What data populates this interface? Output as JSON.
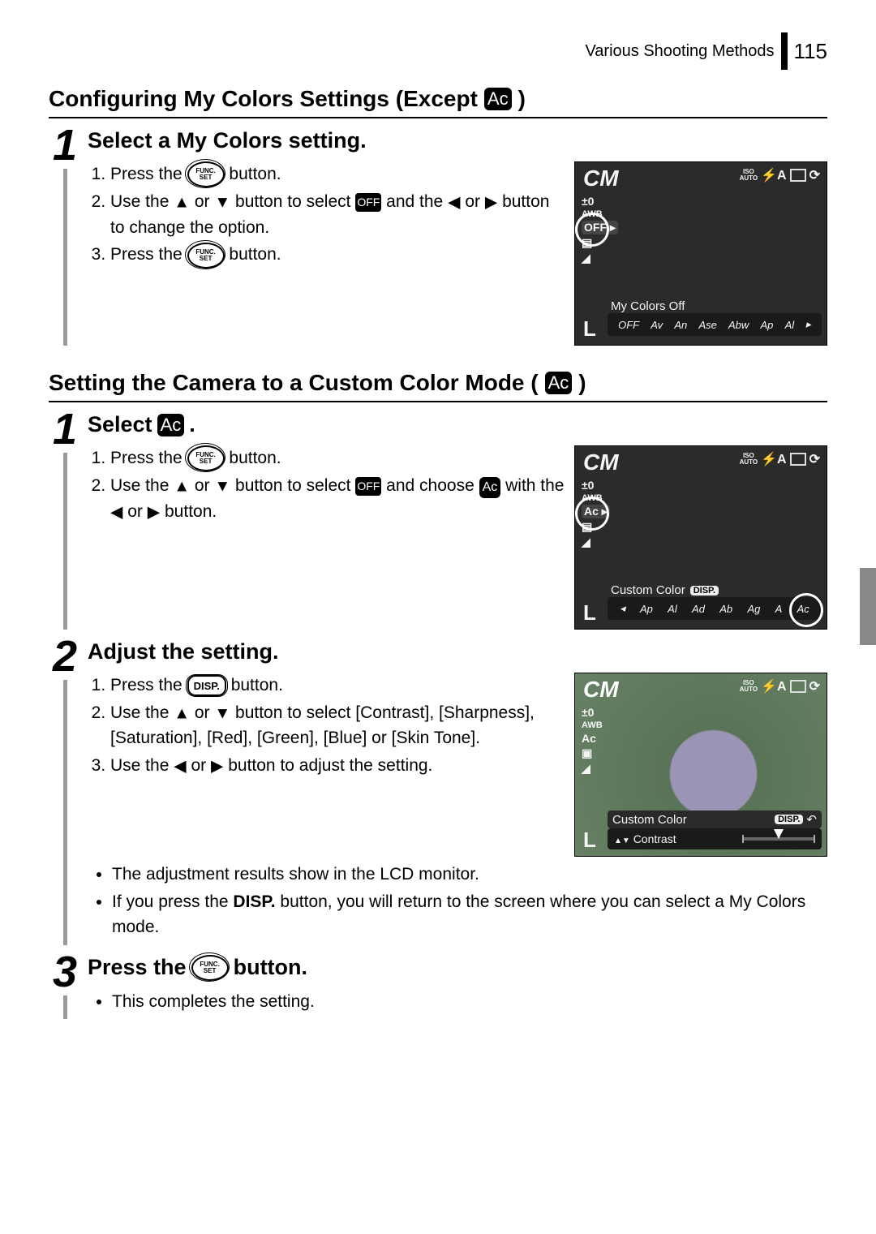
{
  "header": {
    "breadcrumb": "Various Shooting Methods",
    "page_number": "115"
  },
  "section1": {
    "heading_text": "Configuring My Colors Settings (Except",
    "heading_icon": "Ac",
    "heading_close": ")",
    "step1": {
      "num": "1",
      "title": "Select a My Colors setting.",
      "li1_a": "Press the",
      "li1_b": "button.",
      "li2_a": "Use the",
      "li2_b": "or",
      "li2_c": "button to select",
      "li2_d": "and the",
      "li2_e": "or",
      "li2_f": "button to change the option.",
      "li3_a": "Press the",
      "li3_b": "button.",
      "func_top": "FUNC.",
      "func_bot": "SET",
      "off_icon": "OFF"
    },
    "lcd1": {
      "tl": "CM",
      "exp": "±0",
      "awb": "AWB",
      "L": "L",
      "iso": "ISO",
      "auto": "AUTO",
      "bottom_label": "My Colors Off",
      "opt_off": "OFF",
      "opt_v": "Av",
      "opt_n": "An",
      "opt_se": "Ase",
      "opt_bw": "Abw",
      "opt_p": "Ap",
      "opt_l": "Al"
    }
  },
  "section2": {
    "heading_text": "Setting the Camera to a Custom Color Mode (",
    "heading_icon": "Ac",
    "heading_close": ")",
    "step1": {
      "num": "1",
      "title_a": "Select",
      "title_icon": "Ac",
      "title_b": ".",
      "li1_a": "Press the",
      "li1_b": "button.",
      "li2_a": "Use the",
      "li2_b": "or",
      "li2_c": "button to select",
      "li2_d": "and choose",
      "li2_e": "with the",
      "li2_f": "or",
      "li2_g": "button.",
      "ac_icon": "Ac",
      "off_icon": "OFF"
    },
    "lcd1": {
      "tl": "CM",
      "exp": "±0",
      "awb": "AWB",
      "ac": "Ac",
      "L": "L",
      "iso": "ISO",
      "auto": "AUTO",
      "bottom_label": "Custom Color",
      "disp": "DISP.",
      "opt_p": "Ap",
      "opt_l": "Al",
      "opt_d": "Ad",
      "opt_b": "Ab",
      "opt_g": "Ag",
      "opt_r": "A",
      "opt_c": "Ac"
    },
    "step2": {
      "num": "2",
      "title": "Adjust the setting.",
      "li1_a": "Press the",
      "li1_b": "button.",
      "disp": "DISP.",
      "li2_a": "Use the",
      "li2_b": "or",
      "li2_c": "button to select [Contrast], [Sharpness], [Saturation], [Red], [Green], [Blue] or [Skin Tone].",
      "li3_a": "Use the",
      "li3_b": "or",
      "li3_c": "button to adjust the setting.",
      "bul1": "The adjustment results show in the LCD monitor.",
      "bul2_a": "If you press the",
      "bul2_b": "DISP.",
      "bul2_c": "button, you will return to the screen where you can select a My Colors mode."
    },
    "lcd2": {
      "tl": "CM",
      "exp": "±0",
      "awb": "AWB",
      "ac": "Ac",
      "L": "L",
      "iso": "ISO",
      "auto": "AUTO",
      "label": "Custom Color",
      "disp": "DISP.",
      "param": "Contrast"
    },
    "step3": {
      "num": "3",
      "title_a": "Press the",
      "title_b": "button.",
      "bul1": "This completes the setting."
    }
  }
}
